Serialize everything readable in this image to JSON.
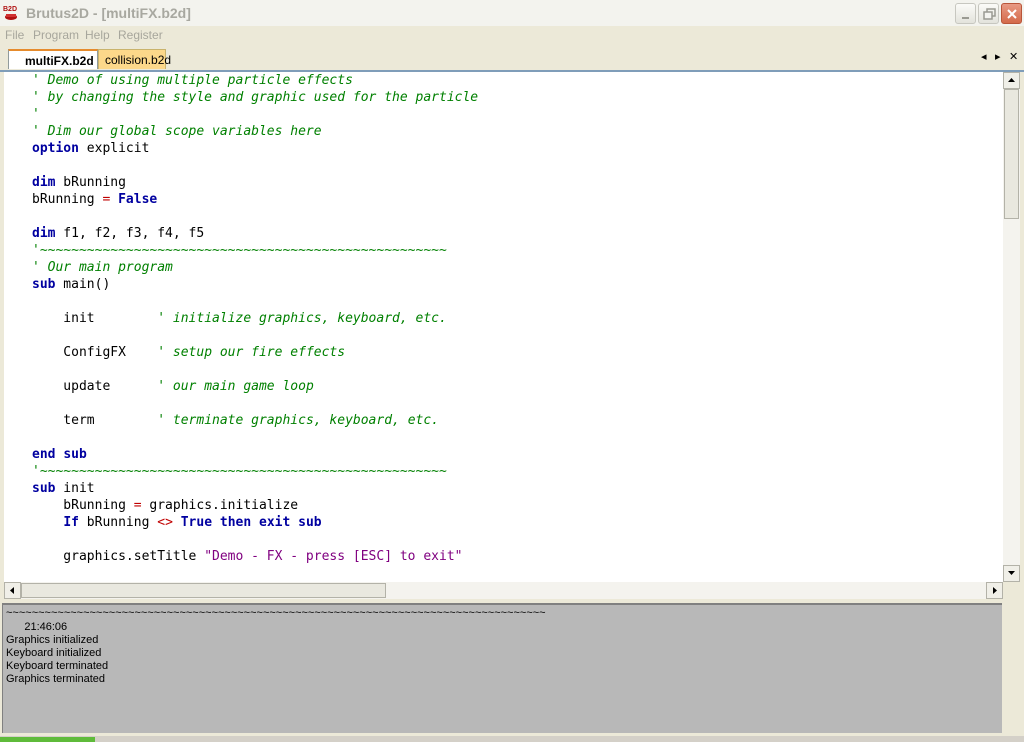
{
  "window": {
    "title": "Brutus2D - [multiFX.b2d]",
    "icon_label": "B2D"
  },
  "menu": [
    "File",
    "Program",
    "Help",
    "Register"
  ],
  "tabs": [
    {
      "label": "multiFX.b2d",
      "active": true
    },
    {
      "label": "collision.b2d",
      "active": false
    }
  ],
  "tab_nav": {
    "prev": "◂",
    "next": "▸",
    "close": "✕"
  },
  "code": [
    [
      {
        "t": "' Demo of using multiple particle effects",
        "c": "cm"
      }
    ],
    [
      {
        "t": "' by changing the style and graphic used for the particle",
        "c": "cm"
      }
    ],
    [
      {
        "t": "'",
        "c": "cm"
      }
    ],
    [
      {
        "t": "' Dim our global scope variables here",
        "c": "cm"
      }
    ],
    [
      {
        "t": "option",
        "c": "kw"
      },
      {
        "t": " explicit",
        "c": "tx"
      }
    ],
    [],
    [
      {
        "t": "dim",
        "c": "kw"
      },
      {
        "t": " bRunning",
        "c": "tx"
      }
    ],
    [
      {
        "t": "bRunning ",
        "c": "tx"
      },
      {
        "t": "=",
        "c": "op"
      },
      {
        "t": " ",
        "c": "tx"
      },
      {
        "t": "False",
        "c": "kw"
      }
    ],
    [],
    [
      {
        "t": "dim",
        "c": "kw"
      },
      {
        "t": " f1, f2, f3, f4, f5",
        "c": "tx"
      }
    ],
    [
      {
        "t": "'~~~~~~~~~~~~~~~~~~~~~~~~~~~~~~~~~~~~~~~~~~~~~~~~~~~~",
        "c": "cm"
      }
    ],
    [
      {
        "t": "' Our main program",
        "c": "cm"
      }
    ],
    [
      {
        "t": "sub",
        "c": "kw"
      },
      {
        "t": " main()",
        "c": "tx"
      }
    ],
    [],
    [
      {
        "t": "    init        ",
        "c": "tx"
      },
      {
        "t": "' initialize graphics, keyboard, etc.",
        "c": "cm"
      }
    ],
    [],
    [
      {
        "t": "    ConfigFX    ",
        "c": "tx"
      },
      {
        "t": "' setup our fire effects",
        "c": "cm"
      }
    ],
    [],
    [
      {
        "t": "    update      ",
        "c": "tx"
      },
      {
        "t": "' our main game loop",
        "c": "cm"
      }
    ],
    [],
    [
      {
        "t": "    term        ",
        "c": "tx"
      },
      {
        "t": "' terminate graphics, keyboard, etc.",
        "c": "cm"
      }
    ],
    [],
    [
      {
        "t": "end",
        "c": "kw"
      },
      {
        "t": " ",
        "c": "tx"
      },
      {
        "t": "sub",
        "c": "kw"
      }
    ],
    [
      {
        "t": "'~~~~~~~~~~~~~~~~~~~~~~~~~~~~~~~~~~~~~~~~~~~~~~~~~~~~",
        "c": "cm"
      }
    ],
    [
      {
        "t": "sub",
        "c": "kw"
      },
      {
        "t": " init",
        "c": "tx"
      }
    ],
    [
      {
        "t": "    bRunning ",
        "c": "tx"
      },
      {
        "t": "=",
        "c": "op"
      },
      {
        "t": " graphics.initialize",
        "c": "tx"
      }
    ],
    [
      {
        "t": "    ",
        "c": "tx"
      },
      {
        "t": "If",
        "c": "kw"
      },
      {
        "t": " bRunning ",
        "c": "tx"
      },
      {
        "t": "<>",
        "c": "op"
      },
      {
        "t": " ",
        "c": "tx"
      },
      {
        "t": "True",
        "c": "kw"
      },
      {
        "t": " ",
        "c": "tx"
      },
      {
        "t": "then",
        "c": "kw"
      },
      {
        "t": " ",
        "c": "tx"
      },
      {
        "t": "exit",
        "c": "kw"
      },
      {
        "t": " ",
        "c": "tx"
      },
      {
        "t": "sub",
        "c": "kw"
      }
    ],
    [],
    [
      {
        "t": "    graphics.setTitle ",
        "c": "tx"
      },
      {
        "t": "\"Demo - FX - press [ESC] to exit\"",
        "c": "st"
      }
    ]
  ],
  "output": {
    "lines": [
      "~~~~~~~~~~~~~~~~~~~~~~~~~~~~~~~~~~~~~~~~~~~~~~~~~~~~~~~~~~~~~~~~~~~~~~~~~~~~~~~~~~~~",
      "      21:46:06",
      "Graphics initialized",
      "Keyboard initialized",
      "Keyboard terminated",
      "Graphics terminated"
    ]
  },
  "colors": {
    "keyword": "#0000a0",
    "comment": "#008000",
    "operator": "#c00000",
    "string": "#800080"
  }
}
